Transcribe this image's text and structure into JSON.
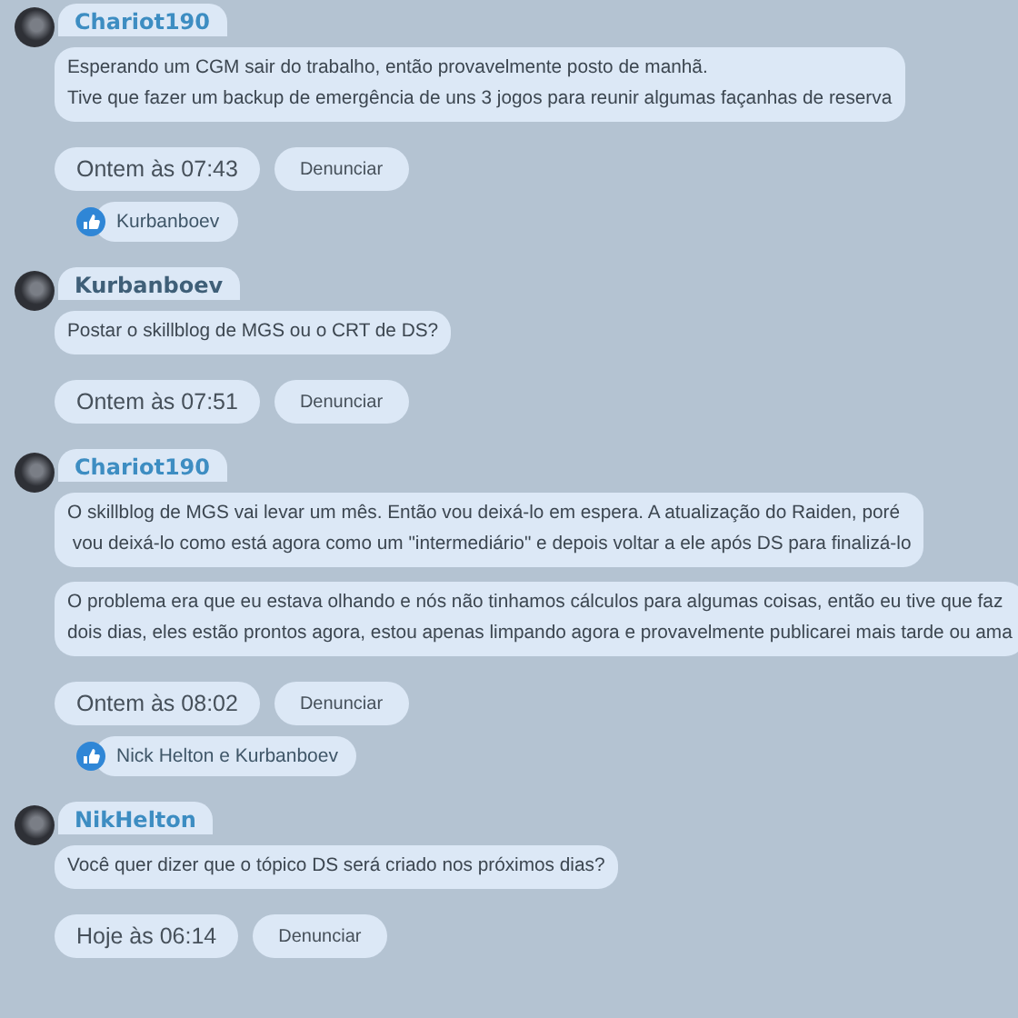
{
  "messages": [
    {
      "author": {
        "name": "Chariot190",
        "color": "#3d8dc2"
      },
      "bubbles": [
        "Esperando um CGM sair do trabalho, então provavelmente posto de manhã.\nTive que fazer um backup de emergência de uns 3 jogos para reunir algumas façanhas de reserva"
      ],
      "time": "Ontem às 07:43",
      "report": "Denunciar",
      "reactions": "Kurbanboev"
    },
    {
      "author": {
        "name": "Kurbanboev",
        "color": "#3f5f78"
      },
      "bubbles": [
        "Postar o skillblog de MGS ou o CRT de DS?"
      ],
      "time": "Ontem às 07:51",
      "report": "Denunciar"
    },
    {
      "author": {
        "name": "Chariot190",
        "color": "#3d8dc2"
      },
      "bubbles": [
        "O skillblog de MGS vai levar um mês. Então vou deixá-lo em espera. A atualização do Raiden, poré\n vou deixá-lo como está agora como um \"intermediário\" e depois voltar a ele após DS para finalizá-lo",
        "O problema era que eu estava olhando e nós não tinhamos cálculos para algumas coisas, então eu tive que faz\ndois dias, eles estão prontos agora, estou apenas limpando agora e provavelmente publicarei mais tarde ou ama"
      ],
      "time": "Ontem às 08:02",
      "report": "Denunciar",
      "reactions": "Nick Helton e Kurbanboev"
    },
    {
      "author": {
        "name": "NikHelton",
        "color": "#3d8dc2"
      },
      "bubbles": [
        "Você quer dizer que o tópico DS será criado nos próximos dias?"
      ],
      "time": "Hoje às 06:14",
      "report": "Denunciar"
    }
  ]
}
